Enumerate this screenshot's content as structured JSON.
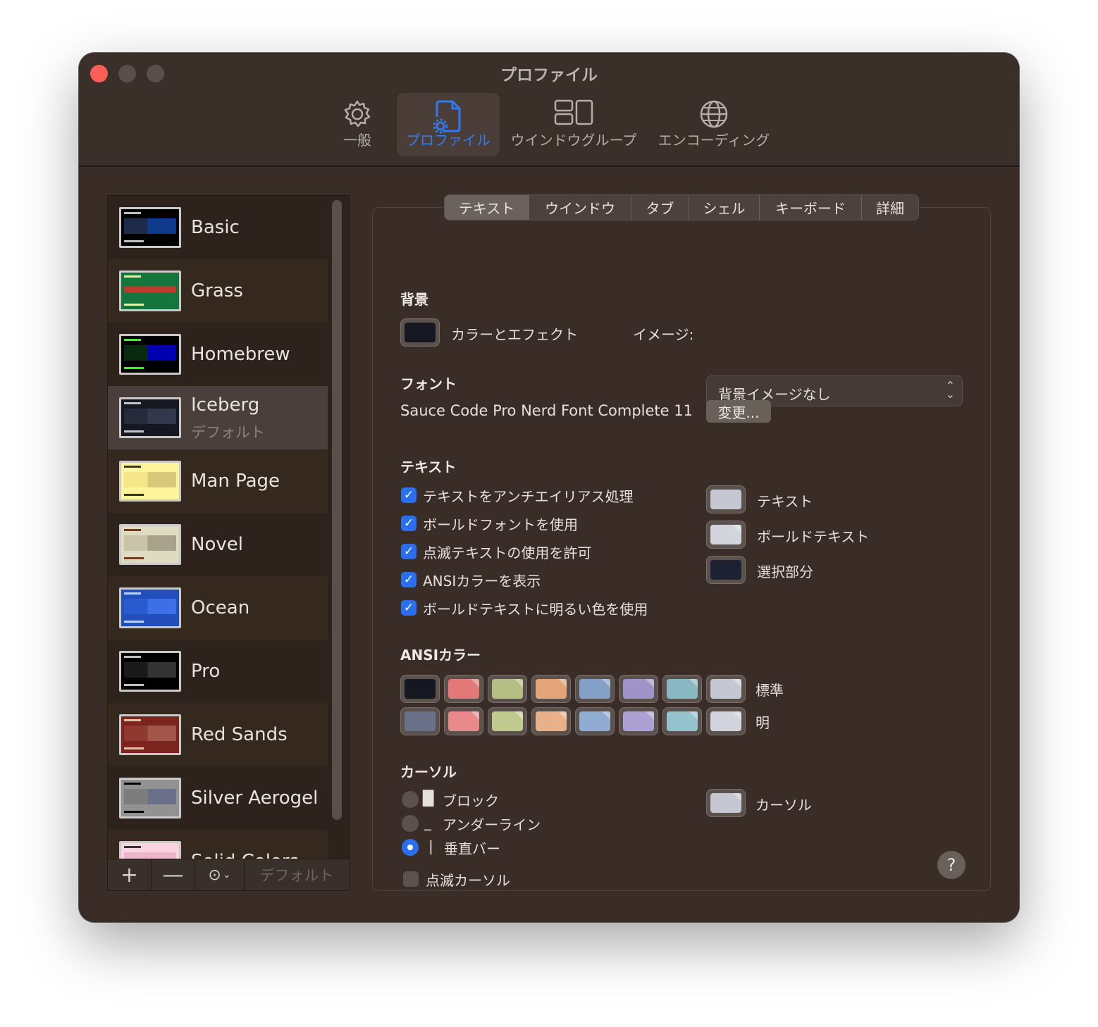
{
  "window": {
    "title": "プロファイル"
  },
  "toolbar": {
    "items": [
      {
        "label": "一般"
      },
      {
        "label": "プロファイル"
      },
      {
        "label": "ウインドウグループ"
      },
      {
        "label": "エンコーディング"
      }
    ]
  },
  "profiles": [
    {
      "name": "Basic"
    },
    {
      "name": "Grass"
    },
    {
      "name": "Homebrew"
    },
    {
      "name": "Iceberg",
      "sub": "デフォルト"
    },
    {
      "name": "Man Page"
    },
    {
      "name": "Novel"
    },
    {
      "name": "Ocean"
    },
    {
      "name": "Pro"
    },
    {
      "name": "Red Sands"
    },
    {
      "name": "Silver Aerogel"
    },
    {
      "name": "Solid Colors"
    }
  ],
  "sidebar_footer": {
    "add": "+",
    "remove": "—",
    "default": "デフォルト"
  },
  "tabs": [
    "テキスト",
    "ウインドウ",
    "タブ",
    "シェル",
    "キーボード",
    "詳細"
  ],
  "background": {
    "heading": "背景",
    "effects_label": "カラーとエフェクト",
    "image_label": "イメージ:",
    "image_value": "背景イメージなし"
  },
  "font": {
    "heading": "フォント",
    "name": "Sauce Code Pro Nerd Font Complete 11",
    "change_button": "変更..."
  },
  "text": {
    "heading": "テキスト",
    "options": [
      {
        "label": "テキストをアンチエイリアス処理",
        "checked": true
      },
      {
        "label": "ボールドフォントを使用",
        "checked": true
      },
      {
        "label": "点滅テキストの使用を許可",
        "checked": true
      },
      {
        "label": "ANSIカラーを表示",
        "checked": true
      },
      {
        "label": "ボールドテキストに明るい色を使用",
        "checked": true
      }
    ],
    "colors": [
      {
        "label": "テキスト",
        "color": "#c6c8d1"
      },
      {
        "label": "ボールドテキスト",
        "color": "#d2d4de"
      },
      {
        "label": "選択部分",
        "color": "#1e2132"
      }
    ]
  },
  "ansi": {
    "heading": "ANSIカラー",
    "normal_label": "標準",
    "bright_label": "明",
    "normal": [
      "#161821",
      "#e27878",
      "#b4be82",
      "#e2a478",
      "#84a0c6",
      "#a093c7",
      "#89b8c2",
      "#c6c8d1"
    ],
    "bright": [
      "#6b7089",
      "#e98989",
      "#c0ca8e",
      "#e9b189",
      "#91acd1",
      "#ada0d3",
      "#95c4ce",
      "#d2d4de"
    ]
  },
  "cursor": {
    "heading": "カーソル",
    "options": [
      {
        "glyph": "█",
        "label": "ブロック",
        "selected": false
      },
      {
        "glyph": "_",
        "label": "アンダーライン",
        "selected": false
      },
      {
        "glyph": "|",
        "label": "垂直バー",
        "selected": true
      }
    ],
    "blink_label": "点滅カーソル",
    "color_label": "カーソル",
    "color": "#c6c8d1"
  },
  "help": "?"
}
